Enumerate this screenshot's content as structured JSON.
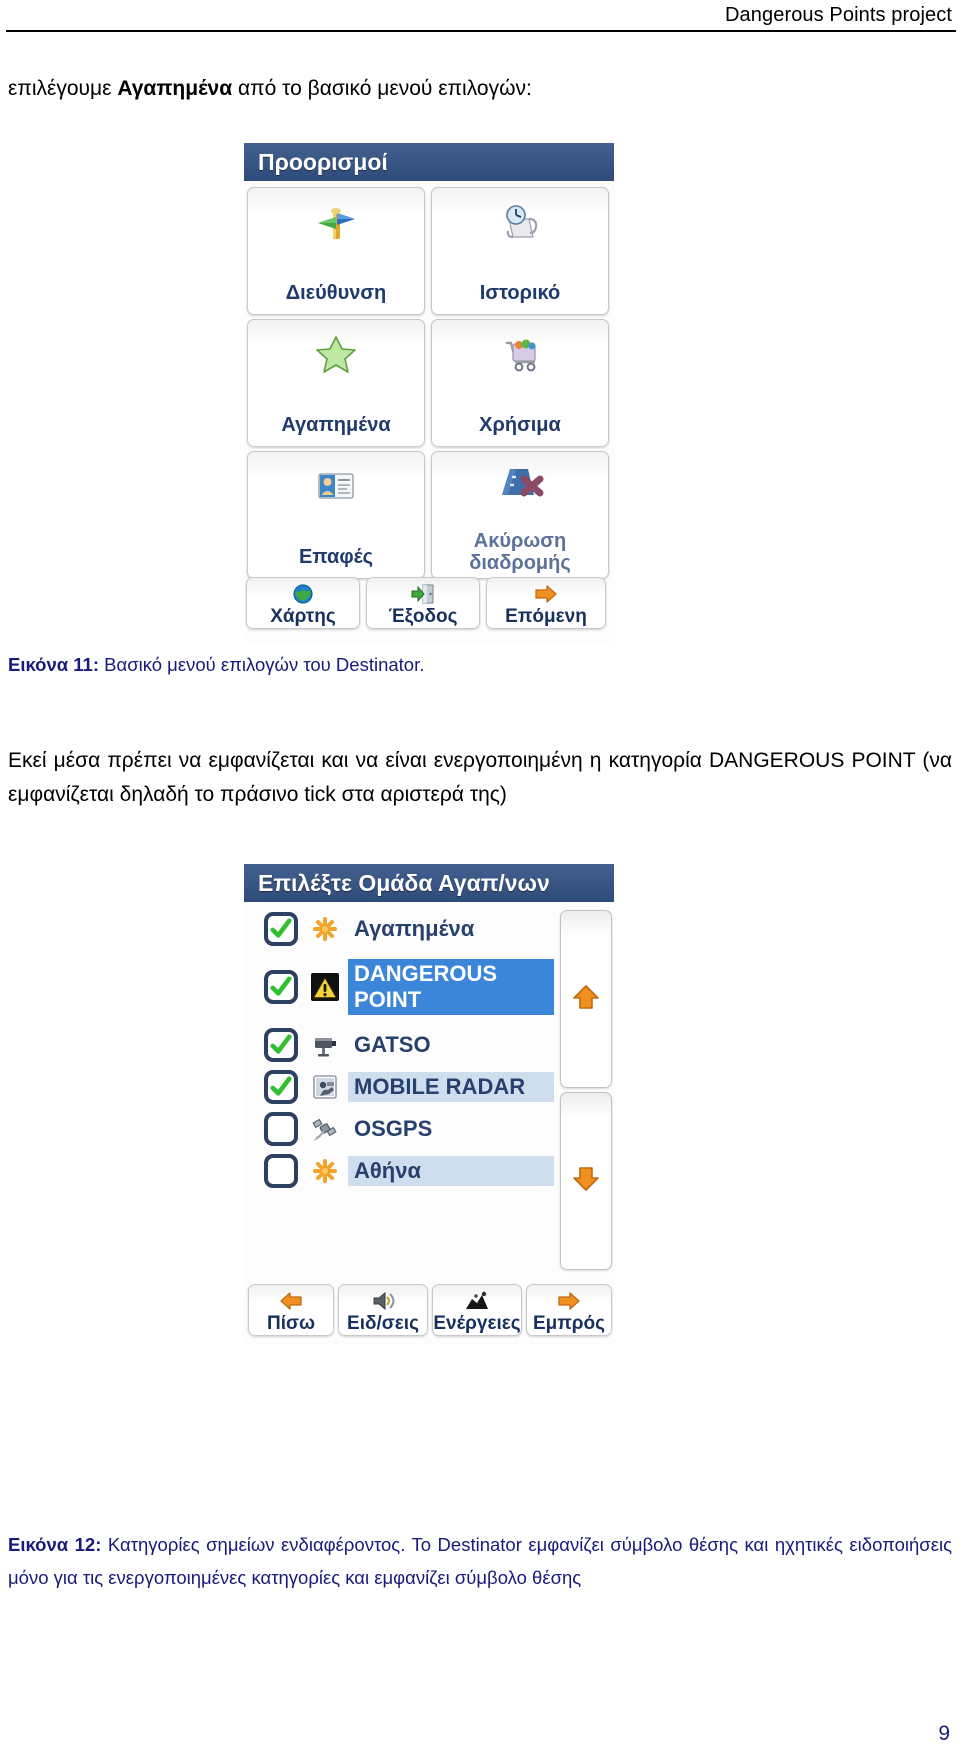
{
  "header": {
    "running_title": "Dangerous Points project"
  },
  "body": {
    "intro_prefix": "επιλέγουμε ",
    "intro_bold": "Αγαπημένα",
    "intro_suffix": " από το βασικό μενού επιλογών:",
    "paragraph2": "Εκεί μέσα πρέπει να εμφανίζεται και να είναι ενεργοποιημένη η κατηγορία DANGEROUS POINT (να εμφανίζεται δηλαδή το πράσινο tick στα αριστερά της)"
  },
  "figure11": {
    "caption_label": "Εικόνα 11:",
    "caption_text": "Βασικό μενού επιλογών του Destinator.",
    "title": "Προορισμοί",
    "tiles": [
      {
        "label": "Διεύθυνση",
        "icon": "signpost-icon",
        "style": "normal"
      },
      {
        "label": "Ιστορικό",
        "icon": "clock-scroll-icon",
        "style": "normal"
      },
      {
        "label": "Αγαπημένα",
        "icon": "star-icon",
        "style": "normal"
      },
      {
        "label": "Χρήσιμα",
        "icon": "shopping-cart-icon",
        "style": "normal"
      },
      {
        "label": "Επαφές",
        "icon": "contact-card-icon",
        "style": "normal"
      },
      {
        "label": "Ακύρωση\nδιαδρομής",
        "line1": "Ακύρωση",
        "line2": "διαδρομής",
        "icon": "cancel-route-icon",
        "style": "disabled"
      }
    ],
    "buttons": [
      {
        "label": "Χάρτης",
        "icon": "globe-icon"
      },
      {
        "label": "Έξοδος",
        "icon": "exit-door-icon"
      },
      {
        "label": "Επόμενη",
        "icon": "arrow-right-icon"
      }
    ]
  },
  "figure12": {
    "caption_label": "Εικόνα 12:",
    "caption_text": "Κατηγορίες σημείων ενδιαφέροντος.  Το Destinator εμφανίζει σύμβολο θέσης και ηχητικές ειδοποιήσεις μόνο για τις ενεργοποιημένες κατηγορίες και εμφανίζει σύμβολο θέσης",
    "title": "Επιλέξτε Ομάδα Αγαπ/νων",
    "rows": [
      {
        "label": "Αγαπημένα",
        "checked": true,
        "icon": "asterisk-orange-icon",
        "highlight": "none"
      },
      {
        "label": "DANGEROUS POINT",
        "checked": true,
        "icon": "warning-triangle-icon",
        "highlight": "selected",
        "lines": [
          "DANGEROUS",
          "POINT"
        ]
      },
      {
        "label": "GATSO",
        "checked": true,
        "icon": "speed-camera-icon",
        "highlight": "none"
      },
      {
        "label": "MOBILE RADAR",
        "checked": true,
        "icon": "mobile-radar-icon",
        "highlight": "alt"
      },
      {
        "label": "OSGPS",
        "checked": false,
        "icon": "satellite-icon",
        "highlight": "none"
      },
      {
        "label": "Αθήνα",
        "checked": false,
        "icon": "asterisk-orange-icon",
        "highlight": "alt"
      }
    ],
    "scroll_up_icon": "scroll-up-arrow-icon",
    "scroll_down_icon": "scroll-down-arrow-icon",
    "buttons": [
      {
        "label": "Πίσω",
        "icon": "arrow-left-icon"
      },
      {
        "label": "Ειδ/σεις",
        "icon": "speaker-icon"
      },
      {
        "label": "Ενέργειες",
        "icon": "actions-icon"
      },
      {
        "label": "Εμπρός",
        "icon": "arrow-right-icon"
      }
    ]
  },
  "footer": {
    "page_number": "9"
  },
  "colors": {
    "title_bar": "#3a5584",
    "caption": "#1a1a7a",
    "tile_label": "#203a6b",
    "selected_row": "#3b86d8",
    "alt_row": "#cfdeef",
    "check_green": "#2fbf2f",
    "checkbox_border": "#2d3f63"
  }
}
